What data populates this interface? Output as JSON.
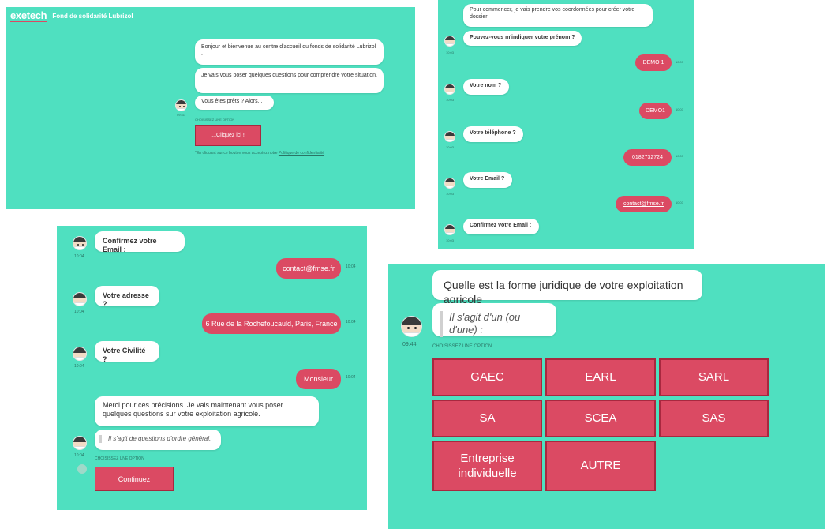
{
  "panel1": {
    "logo": "exetech",
    "title": "Fond de solidarité Lubrizol",
    "msg1": "Bonjour et bienvenue au centre d'accueil du fonds de solidarité Lubrizol .",
    "msg2": "Je vais vous poser quelques questions pour comprendre votre situation.",
    "msg3": "Vous êtes prêts ? Alors...",
    "time": "09:41",
    "choose_label": "CHOISISSEZ UNE OPTION",
    "button": "...Cliquez ici !",
    "disclaimer_prefix": "*En cliquant sur ce bouton vous acceptez notre",
    "disclaimer_link": "Politique de confidentialité"
  },
  "panel2": {
    "msg_intro": "Pour commencer, je vais prendre vos coordonnées pour créer votre dossier",
    "q_prenom": "Pouvez-vous m'indiquer votre prénom ?",
    "a_prenom": "DEMO 1",
    "q_nom": "Votre nom ?",
    "a_nom": "DEMO1",
    "q_tel": "Votre téléphone ?",
    "a_tel": "0182732724",
    "q_email": "Votre Email ?",
    "a_email": "contact@fmse.fr",
    "q_confirm": "Confirmez votre Email :",
    "time": "10:03"
  },
  "panel3": {
    "q_confirm": "Confirmez votre Email :",
    "a_email": "contact@fmse.fr",
    "q_adresse": "Votre adresse ?",
    "a_adresse": "6 Rue de la Rochefoucauld, Paris, France",
    "q_civilite": "Votre Civilité ?",
    "a_civilite": "Monsieur",
    "msg_merci": "Merci pour ces précisions. Je vais maintenant vous poser quelques questions sur votre exploitation agricole.",
    "msg_general": "Il s'agit de questions d'ordre général.",
    "choose_label": "CHOISISSEZ UNE OPTION",
    "button": "Continuez",
    "time": "10:04"
  },
  "panel4": {
    "question": "Quelle est la forme juridique de votre exploitation agricole",
    "quote": "Il s'agit d'un (ou d'une) :",
    "time": "09:44",
    "choose_label": "CHOISISSEZ UNE OPTION",
    "options": [
      "GAEC",
      "EARL",
      "SARL",
      "SA",
      "SCEA",
      "SAS",
      "Entreprise individuelle",
      "AUTRE"
    ]
  },
  "colors": {
    "panel_bg": "#4fe0c0",
    "accent": "#db4a63",
    "bubble": "#ffffff"
  }
}
